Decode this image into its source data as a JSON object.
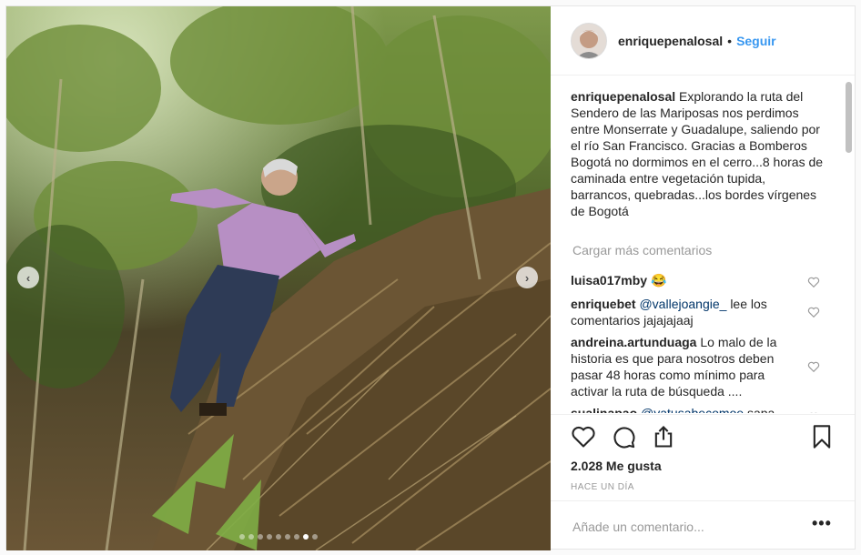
{
  "post": {
    "author": "enriquepenalosal",
    "separator": "•",
    "follow_label": "Seguir",
    "caption": "Explorando la ruta del Sendero de las Mariposas nos perdimos entre Monserrate y Guadalupe, saliendo por el río San Francisco. Gracias a Bomberos Bogotá no dormimos en el cerro...8 horas de caminada entre vegetación tupida, barrancos, quebradas...los bordes vírgenes de Bogotá",
    "load_more": "Cargar más comentarios",
    "comments": [
      {
        "user": "luisa017mby",
        "mention": "",
        "text": "😂"
      },
      {
        "user": "enriquebet",
        "mention": "@vallejoangie_",
        "text": "lee los comentarios jajajajaaj"
      },
      {
        "user": "andreina.artunduaga",
        "mention": "",
        "text": "Lo malo de la historia es que para nosotros deben pasar 48 horas como mínimo para activar la ruta de búsqueda ...."
      },
      {
        "user": "sualinapao",
        "mention": "@yatusabecomoe",
        "text": "sapa"
      }
    ],
    "likes": "2.028 Me gusta",
    "time": "HACE UN DÍA",
    "add_comment_placeholder": "Añade un comentario...",
    "more_options": "•••",
    "carousel": {
      "count": 9,
      "active": 7
    }
  },
  "icons": {
    "prev": "chevron-left-icon",
    "next": "chevron-right-icon",
    "like": "heart-icon",
    "comment": "comment-bubble-icon",
    "share": "share-icon",
    "save": "bookmark-icon"
  },
  "colors": {
    "link": "#3897f0",
    "mention": "#003569",
    "muted": "#999999",
    "text": "#262626"
  }
}
